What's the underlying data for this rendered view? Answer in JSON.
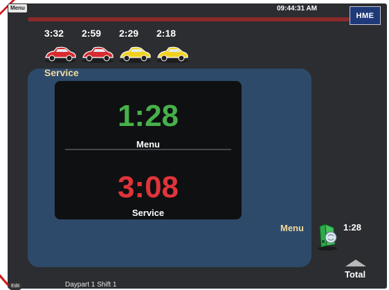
{
  "header": {
    "menu_tag": "Menu",
    "clock": "09:44:31 AM",
    "brand": "HME"
  },
  "queue": [
    {
      "time": "3:32",
      "car_color": "#d82a30",
      "icon": "red-car-icon"
    },
    {
      "time": "2:59",
      "car_color": "#d82a30",
      "icon": "red-car-icon"
    },
    {
      "time": "2:29",
      "car_color": "#f0d21e",
      "icon": "yellow-car-icon"
    },
    {
      "time": "2:18",
      "car_color": "#f0d21e",
      "icon": "yellow-car-icon"
    }
  ],
  "service_panel": {
    "title": "Service",
    "menu_time": "1:28",
    "menu_label": "Menu",
    "service_time": "3:08",
    "service_label": "Service"
  },
  "lane": {
    "label": "Menu",
    "time": "1:28",
    "icon": "menu-board-speaker-icon"
  },
  "total": {
    "label": "Total",
    "icon": "up-arrow-icon"
  },
  "footer": {
    "edit_tag": "Edit",
    "daypart": "Daypart 1 Shift 1"
  },
  "colors": {
    "screen_bg": "#2b2d30",
    "panel_bg": "#2e4a6a",
    "good": "#46b14a",
    "alert": "#e0343a",
    "accent_text": "#f1d9a0",
    "brand_bg": "#1f3a78"
  }
}
